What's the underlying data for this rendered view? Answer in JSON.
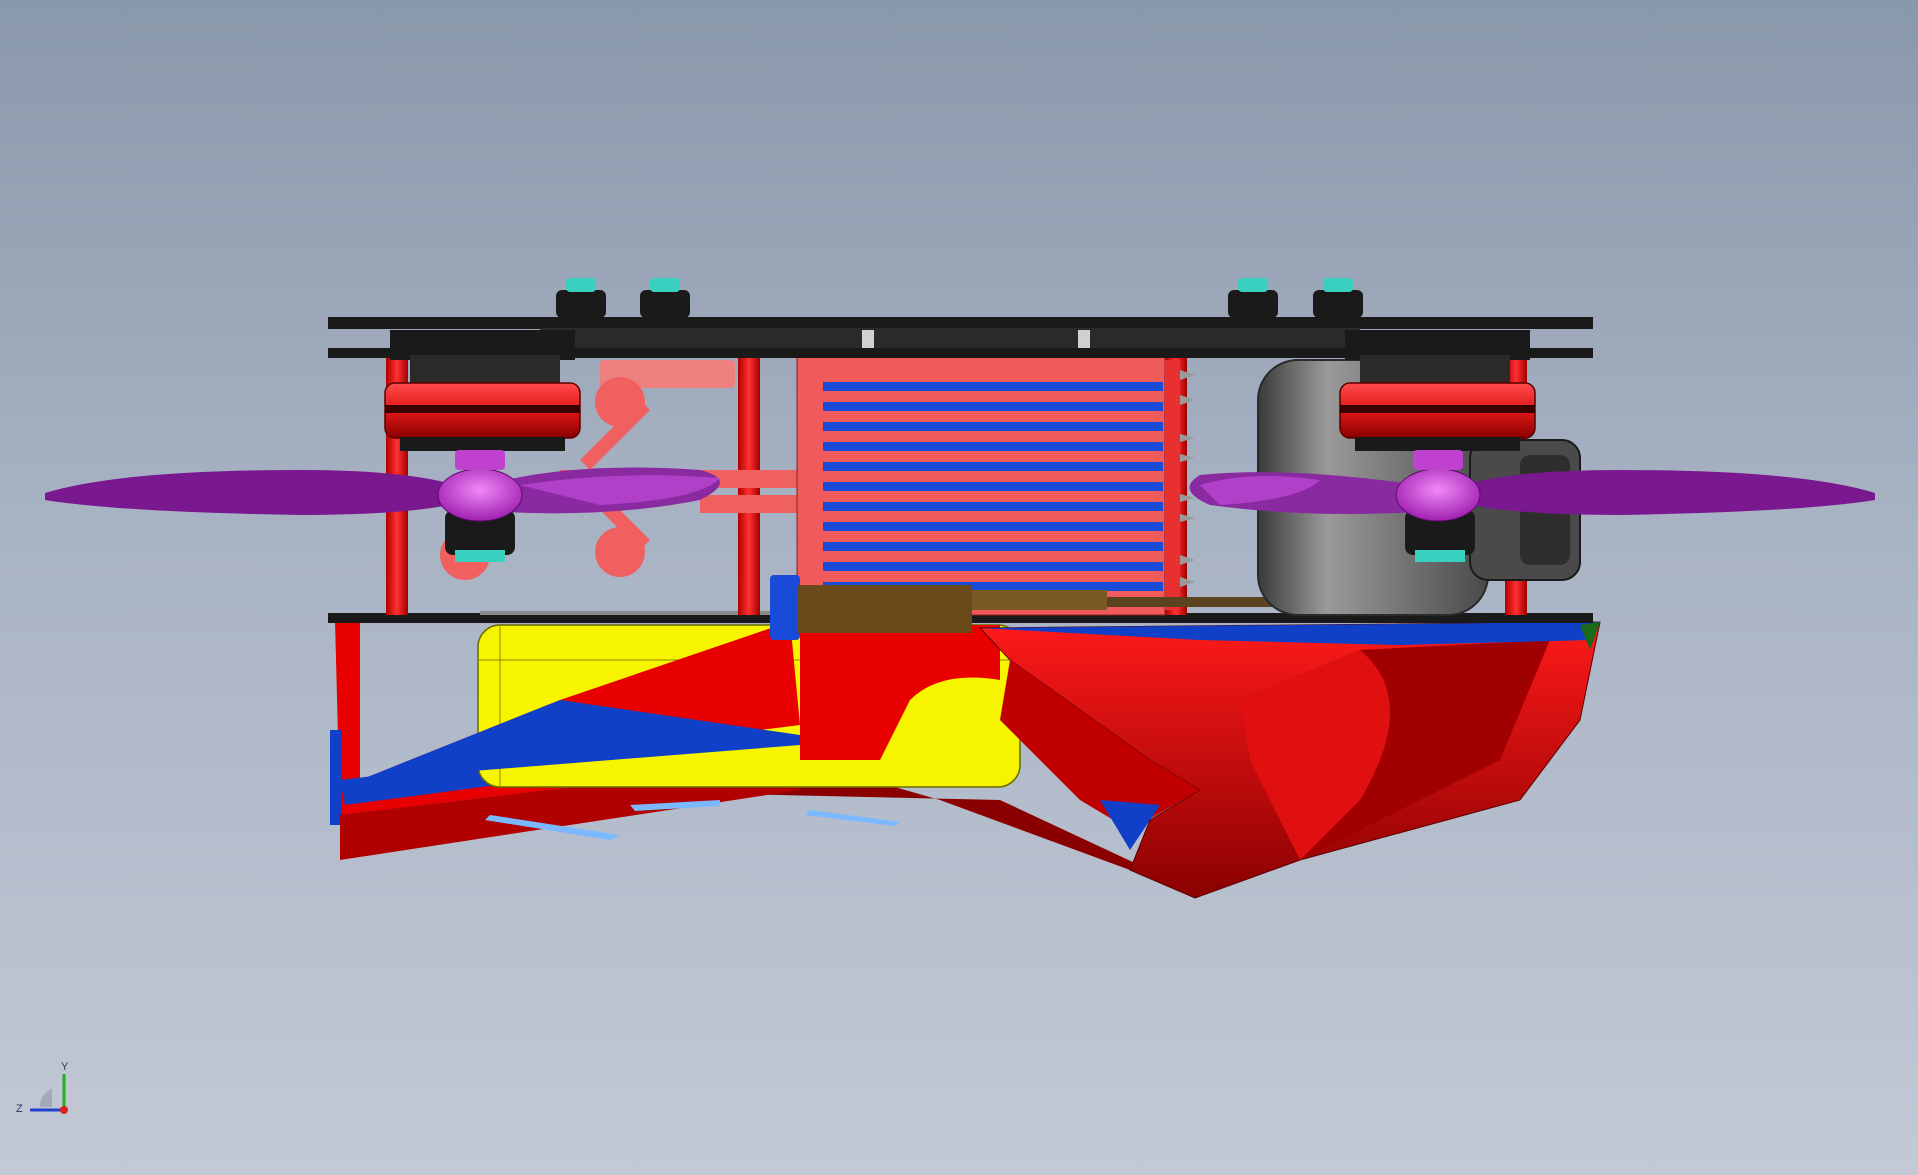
{
  "viewport": {
    "background_top": "#8a98ab",
    "background_bottom": "#c3c9d5"
  },
  "model": {
    "parts": [
      "top-plate-icon",
      "bottom-plate-icon",
      "motor-left-icon",
      "motor-right-icon",
      "propeller-left-icon",
      "propeller-right-icon",
      "standoff-icon",
      "flight-controller-icon",
      "camera-icon",
      "battery-icon",
      "antenna-icon",
      "body-shell-icon"
    ],
    "colors": {
      "plate": "#1a1a1a",
      "motor_bell": "#e01818",
      "propeller": "#8a1a9a",
      "prop_hub": "#c040d0",
      "standoff": "#e02020",
      "flight_controller": "#f05a5a",
      "fc_stripe": "#1a4ad8",
      "camera": "#6a6a6a",
      "battery": "#f7f400",
      "shell_red": "#e80000",
      "shell_dark": "#9a0000",
      "shell_blue": "#1040c8",
      "screw": "#3ad0c0"
    }
  },
  "triad": {
    "y_label": "Y",
    "z_label": "Z",
    "x_color": "#e02020",
    "y_color": "#20b020",
    "z_color": "#2040d0"
  }
}
